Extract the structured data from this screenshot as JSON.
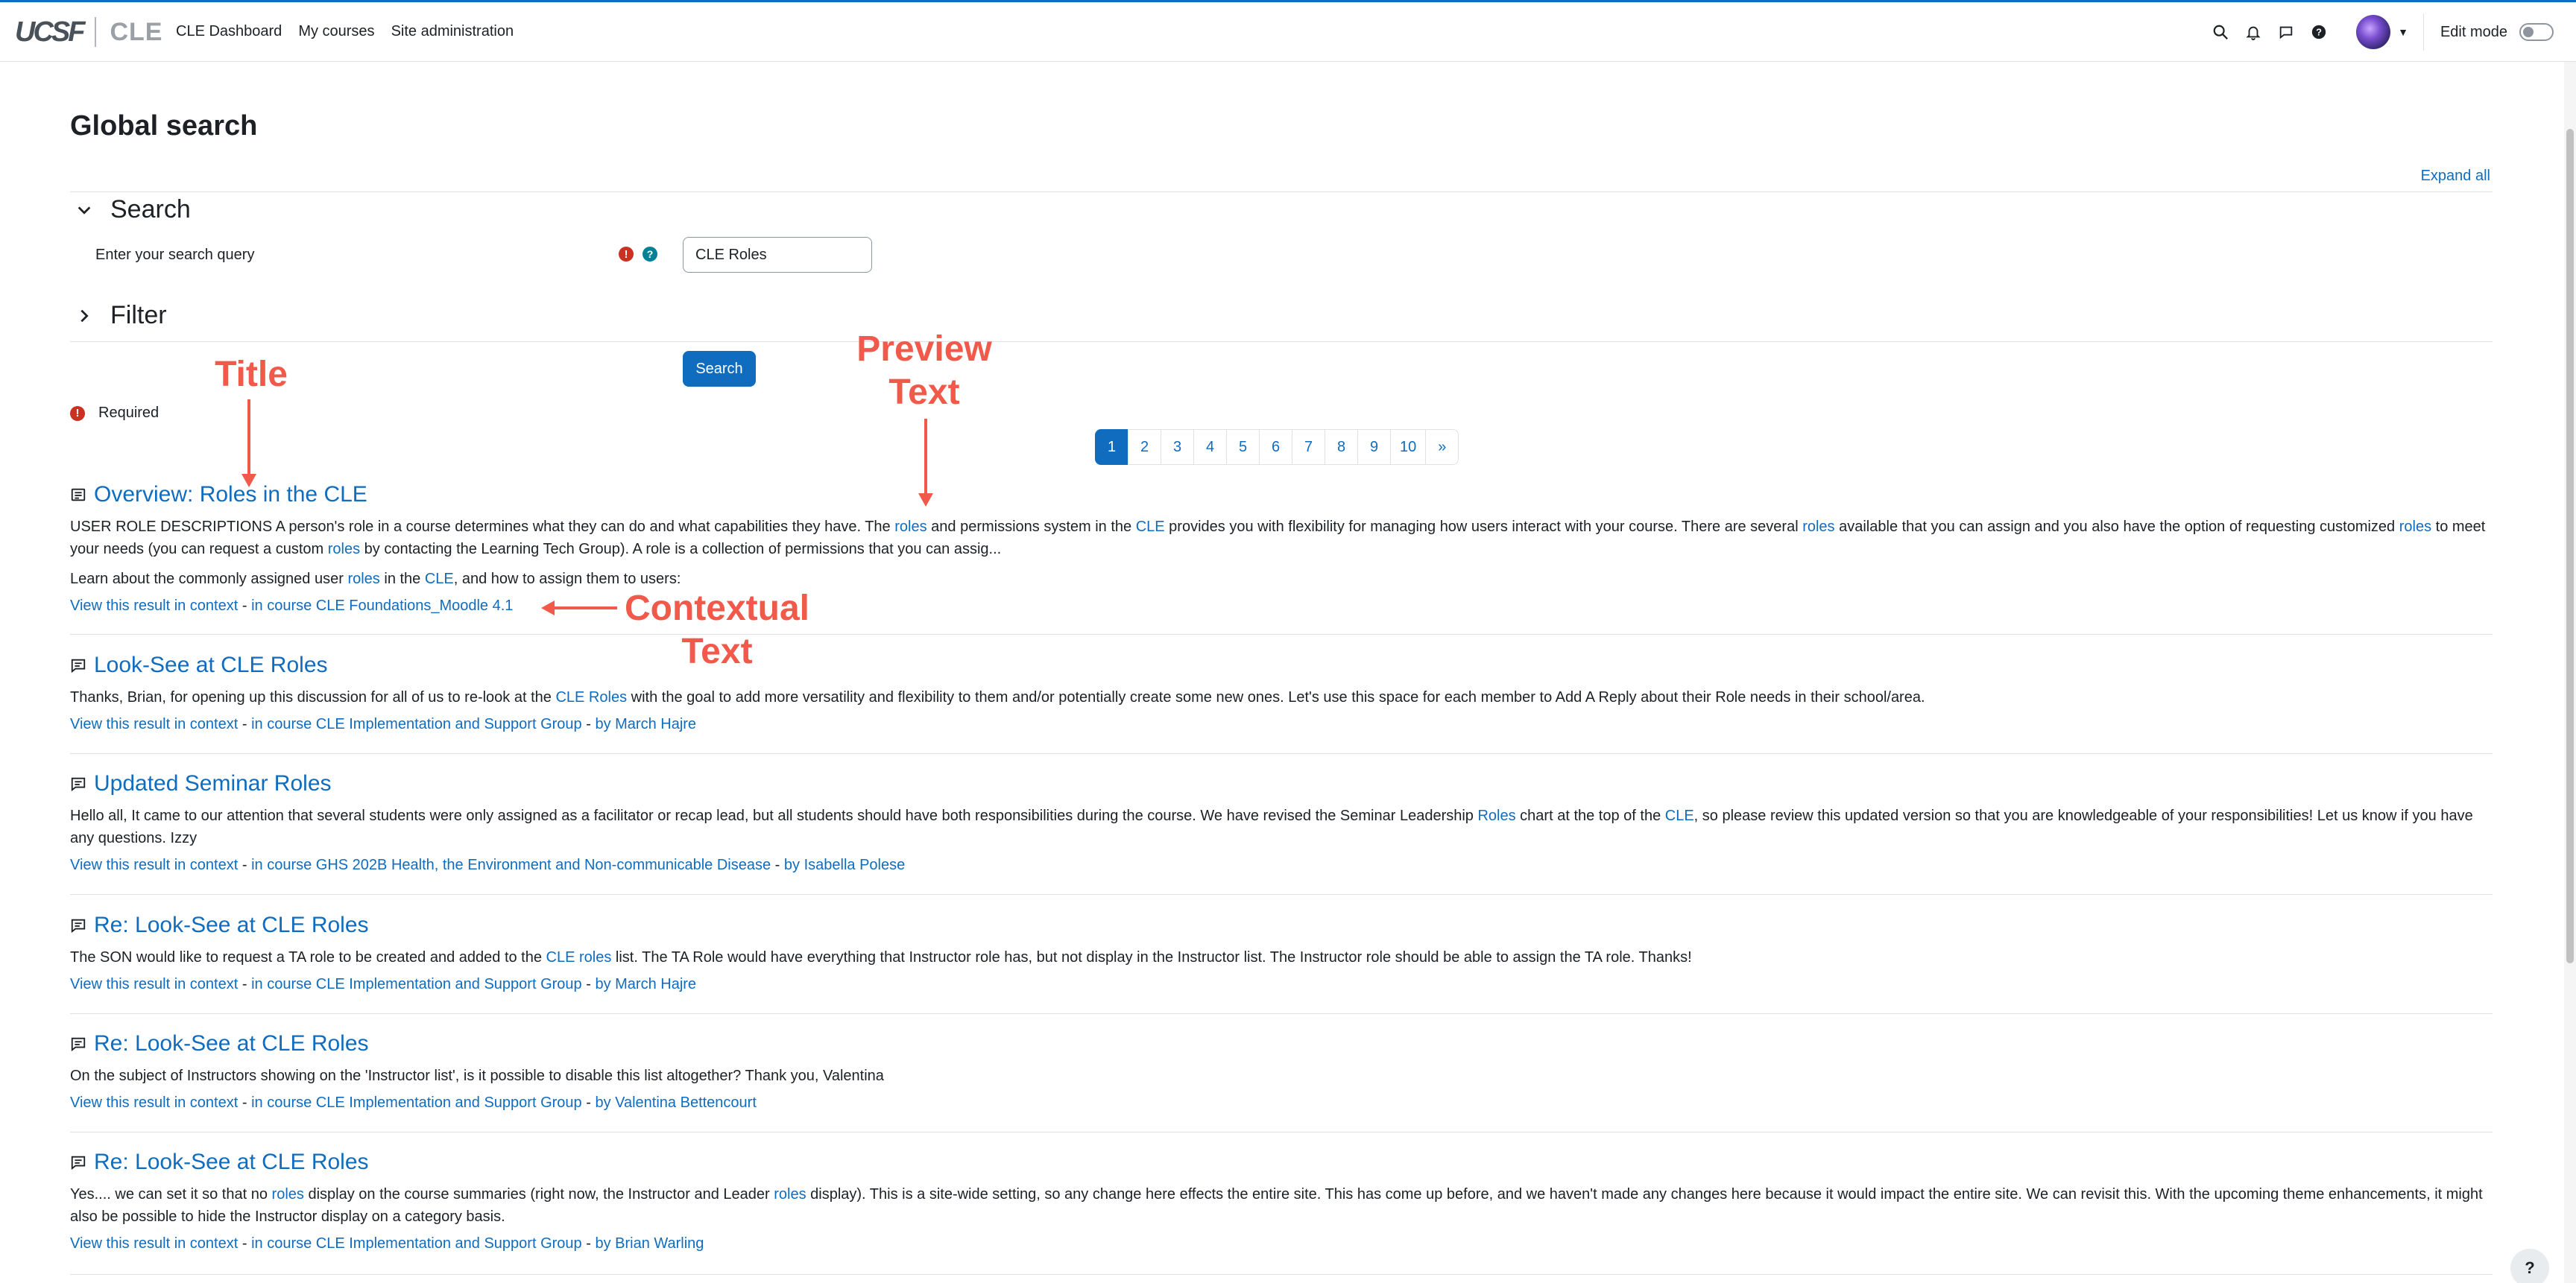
{
  "header": {
    "brand_ucsf": "UCSF",
    "brand_cle": "CLE",
    "nav": [
      "CLE Dashboard",
      "My courses",
      "Site administration"
    ],
    "edit_mode_label": "Edit mode"
  },
  "page": {
    "title": "Global search",
    "expand_all": "Expand all"
  },
  "search_section": {
    "title": "Search",
    "query_label": "Enter your search query",
    "query_value": "CLE Roles",
    "filter_title": "Filter",
    "search_button": "Search",
    "required_label": "Required"
  },
  "pagination": {
    "pages": [
      "1",
      "2",
      "3",
      "4",
      "5",
      "6",
      "7",
      "8",
      "9",
      "10"
    ],
    "next": "»",
    "active": "1"
  },
  "results": [
    {
      "title": "Overview: Roles in the CLE",
      "text_parts": [
        {
          "t": "USER ROLE DESCRIPTIONS A person's role in a course determines what they can do and what capabilities they have. The "
        },
        {
          "t": "roles",
          "hl": true
        },
        {
          "t": " and permissions system in the "
        },
        {
          "t": "CLE",
          "hl": true
        },
        {
          "t": " provides you with flexibility for managing how users interact with your course. There are several "
        },
        {
          "t": "roles",
          "hl": true
        },
        {
          "t": " available that you can assign and you also have the option of requesting customized "
        },
        {
          "t": "roles",
          "hl": true
        },
        {
          "t": " to meet your needs (you can request a custom "
        },
        {
          "t": "roles",
          "hl": true
        },
        {
          "t": " by contacting the Learning Tech Group). A role is a collection of permissions that you can assig..."
        }
      ],
      "text2_parts": [
        {
          "t": "Learn about the commonly assigned user "
        },
        {
          "t": "roles",
          "hl": true
        },
        {
          "t": " in the "
        },
        {
          "t": "CLE",
          "hl": true
        },
        {
          "t": ", and how to assign them to users:"
        }
      ],
      "context_link": "View this result in context",
      "course": "in course CLE Foundations_Moodle 4.1",
      "author": ""
    },
    {
      "title": "Look-See at CLE Roles",
      "text_parts": [
        {
          "t": "Thanks, Brian, for opening up this discussion for all of us to re-look at the "
        },
        {
          "t": "CLE Roles",
          "hl": true
        },
        {
          "t": " with the goal to add more versatility and flexibility to them and/or potentially create some new ones. Let's use this space for each member to Add A Reply about their Role needs in their school/area."
        }
      ],
      "context_link": "View this result in context",
      "course": "in course CLE Implementation and Support Group",
      "author": "by March Hajre"
    },
    {
      "title": "Updated Seminar Roles",
      "text_parts": [
        {
          "t": "Hello all, It came to our attention that several students were only assigned as a facilitator or recap lead, but all students should have both responsibilities during the course. We have revised the Seminar Leadership "
        },
        {
          "t": "Roles",
          "hl": true
        },
        {
          "t": " chart at the top of the "
        },
        {
          "t": "CLE",
          "hl": true
        },
        {
          "t": ", so please review this updated version so that you are knowledgeable of your responsibilities! Let us know if you have any questions. Izzy"
        }
      ],
      "context_link": "View this result in context",
      "course": "in course GHS 202B Health, the Environment and Non-communicable Disease",
      "author": "by Isabella Polese"
    },
    {
      "title": "Re: Look-See at CLE Roles",
      "text_parts": [
        {
          "t": "The SON would like to request a TA role to be created and added to the "
        },
        {
          "t": "CLE roles",
          "hl": true
        },
        {
          "t": " list. The TA Role would have everything that Instructor role has, but not display in the Instructor list. The Instructor role should be able to assign the TA role. Thanks!"
        }
      ],
      "context_link": "View this result in context",
      "course": "in course CLE Implementation and Support Group",
      "author": "by March Hajre"
    },
    {
      "title": "Re: Look-See at CLE Roles",
      "text_parts": [
        {
          "t": "On the subject of Instructors showing on the 'Instructor list', is it possible to disable this list altogether? Thank you, Valentina"
        }
      ],
      "context_link": "View this result in context",
      "course": "in course CLE Implementation and Support Group",
      "author": "by Valentina Bettencourt"
    },
    {
      "title": "Re: Look-See at CLE Roles",
      "text_parts": [
        {
          "t": "Yes.... we can set it so that no "
        },
        {
          "t": "roles",
          "hl": true
        },
        {
          "t": " display on the course summaries (right now, the Instructor and Leader "
        },
        {
          "t": "roles",
          "hl": true
        },
        {
          "t": " display). This is a site-wide setting, so any change here effects the entire site. This has come up before, and we haven't made any changes here because it would impact the entire site. We can revisit this. With the upcoming theme enhancements, it might also be possible to hide the Instructor display on a category basis."
        }
      ],
      "context_link": "View this result in context",
      "course": "in course CLE Implementation and Support Group",
      "author": "by Brian Warling"
    }
  ],
  "annotations": {
    "title": "Title",
    "preview_line1": "Preview",
    "preview_line2": "Text",
    "contextual_line1": "Contextual",
    "contextual_line2": "Text",
    "color": "#f15a4a"
  },
  "help_fab": "?",
  "colors": {
    "accent": "#0f6cbf",
    "required": "#ca3120",
    "help": "#008196"
  }
}
